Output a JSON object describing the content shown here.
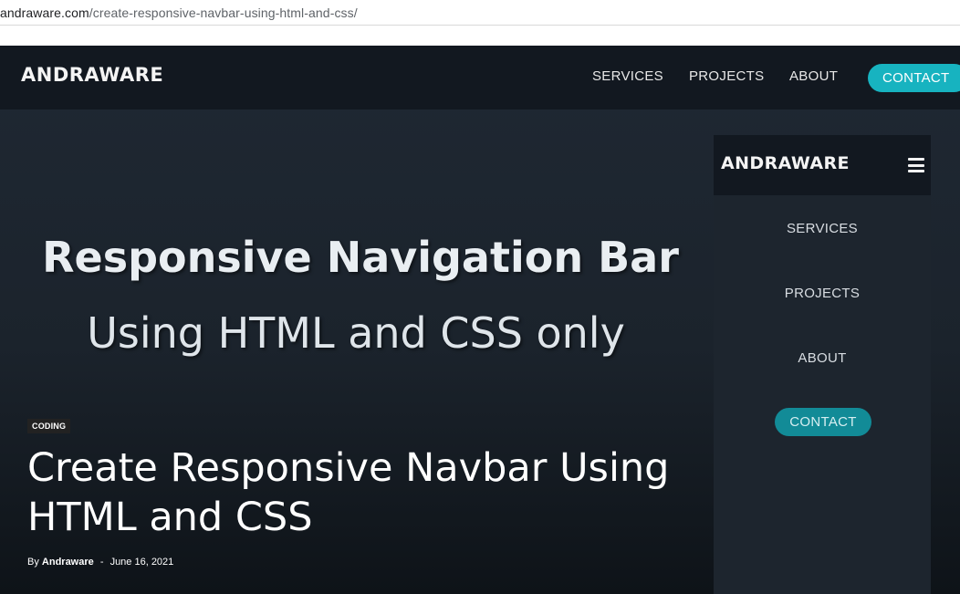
{
  "browser": {
    "url_domain": "andraware.com",
    "url_path": "/create-responsive-navbar-using-html-and-css/"
  },
  "navbar": {
    "logo": "ANDRAWARE",
    "links": [
      "SERVICES",
      "PROJECTS",
      "ABOUT"
    ],
    "contact_label": "CONTACT"
  },
  "banner": {
    "title": "Responsive Navigation Bar",
    "subtitle": "Using HTML and CSS only"
  },
  "mobile_nav": {
    "logo": "ANDRAWARE",
    "menu_icon": "hamburger-menu-icon",
    "items": [
      "SERVICES",
      "PROJECTS",
      "ABOUT"
    ],
    "contact_label": "CONTACT"
  },
  "article": {
    "category": "CODING",
    "title": "Create Responsive Navbar Using HTML and CSS",
    "by_label": "By",
    "author": "Andraware",
    "separator": "-",
    "date": "June 16, 2021"
  },
  "colors": {
    "accent": "#17b3c0",
    "accent_dim": "#128b97",
    "nav_background": "#121820",
    "hero_background": "#1f2833"
  }
}
